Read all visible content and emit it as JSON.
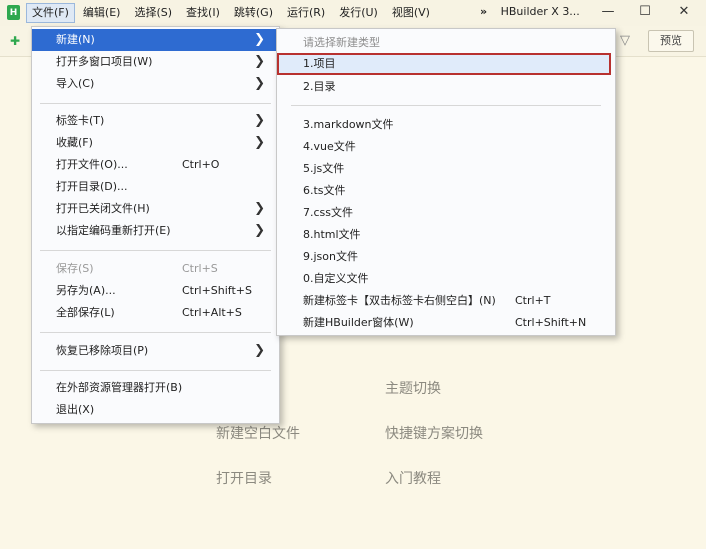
{
  "titlebar": {
    "logo": "H",
    "title": "HBuilder X 3...",
    "overflow": "»",
    "minimize": "—",
    "maximize": "☐",
    "close": "✕"
  },
  "menubar": [
    {
      "label": "文件(F)"
    },
    {
      "label": "编辑(E)"
    },
    {
      "label": "选择(S)"
    },
    {
      "label": "查找(I)"
    },
    {
      "label": "跳转(G)"
    },
    {
      "label": "运行(R)"
    },
    {
      "label": "发行(U)"
    },
    {
      "label": "视图(V)"
    }
  ],
  "toolbar": {
    "preview": "预览"
  },
  "welcome": {
    "theme": "主题切换",
    "new_blank": "新建空白文件",
    "keymap": "快捷键方案切换",
    "open_dir": "打开目录",
    "tutorial": "入门教程"
  },
  "file_menu": {
    "new": "新建(N)",
    "open_multi": "打开多窗口项目(W)",
    "import": "导入(C)",
    "tabs": "标签卡(T)",
    "favorites": "收藏(F)",
    "open_file": "打开文件(O)...",
    "open_file_sc": "Ctrl+O",
    "open_dir": "打开目录(D)...",
    "open_closed": "打开已关闭文件(H)",
    "reopen_encoding": "以指定编码重新打开(E)",
    "save": "保存(S)",
    "save_sc": "Ctrl+S",
    "save_as": "另存为(A)...",
    "save_as_sc": "Ctrl+Shift+S",
    "save_all": "全部保存(L)",
    "save_all_sc": "Ctrl+Alt+S",
    "restore_removed": "恢复已移除项目(P)",
    "open_in_explorer": "在外部资源管理器打开(B)",
    "exit": "退出(X)"
  },
  "new_submenu": {
    "header": "请选择新建类型",
    "project": "1.项目",
    "directory": "2.目录",
    "markdown": "3.markdown文件",
    "vue": "4.vue文件",
    "js": "5.js文件",
    "ts": "6.ts文件",
    "css": "7.css文件",
    "html": "8.html文件",
    "json": "9.json文件",
    "custom": "0.自定义文件",
    "new_tab": "新建标签卡【双击标签卡右侧空白】(N)",
    "new_tab_sc": "Ctrl+T",
    "new_window": "新建HBuilder窗体(W)",
    "new_window_sc": "Ctrl+Shift+N"
  },
  "colors": {
    "highlight": "#2e6bd1",
    "selected_border": "#b8312f",
    "background": "#fbf7e7"
  }
}
